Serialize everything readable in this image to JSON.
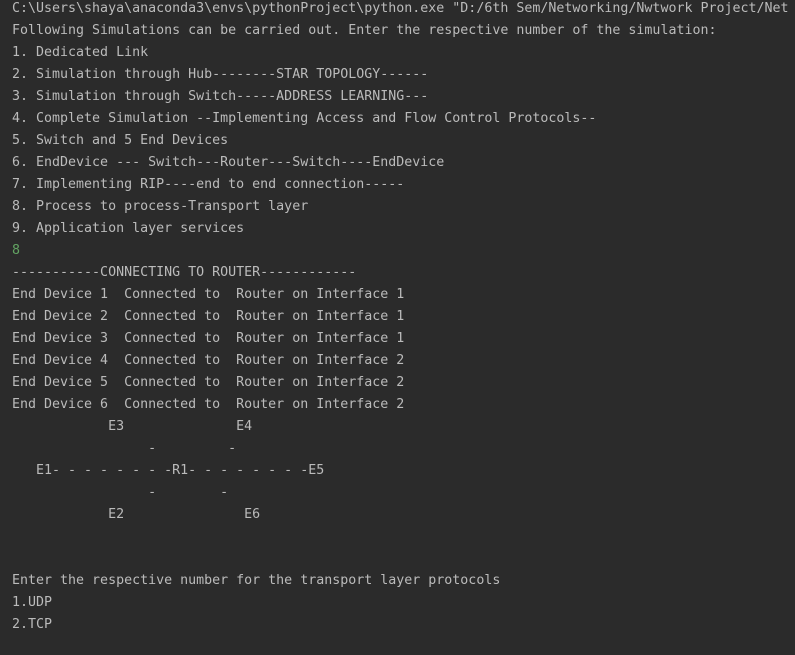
{
  "console": {
    "command": "C:\\Users\\shaya\\anaconda3\\envs\\pythonProject\\python.exe \"D:/6th Sem/Networking/Nwtwork Project/Net",
    "intro": "Following Simulations can be carried out. Enter the respective number of the simulation:",
    "menu": [
      "1. Dedicated Link",
      "2. Simulation through Hub--------STAR TOPOLOGY------",
      "3. Simulation through Switch-----ADDRESS LEARNING---",
      "4. Complete Simulation --Implementing Access and Flow Control Protocols--",
      "5. Switch and 5 End Devices",
      "6. EndDevice --- Switch---Router---Switch----EndDevice",
      "7. Implementing RIP----end to end connection-----",
      "8. Process to process-Transport layer",
      "9. Application layer services"
    ],
    "user_input": "8",
    "connecting_header": "-----------CONNECTING TO ROUTER------------",
    "connections": [
      "End Device 1  Connected to  Router on Interface 1",
      "End Device 2  Connected to  Router on Interface 1",
      "End Device 3  Connected to  Router on Interface 1",
      "End Device 4  Connected to  Router on Interface 2",
      "End Device 5  Connected to  Router on Interface 2",
      "End Device 6  Connected to  Router on Interface 2"
    ],
    "topology": [
      "            E3              E4",
      "                 -         -",
      "   E1- - - - - - - -R1- - - - - - - -E5",
      "                 -        -",
      "            E2               E6"
    ],
    "transport_prompt": "Enter the respective number for the transport layer protocols",
    "transport_options": [
      "1.UDP",
      "2.TCP"
    ]
  },
  "colors": {
    "background": "#2b2b2b",
    "text": "#bbbbbb",
    "user_input": "#62a362"
  }
}
